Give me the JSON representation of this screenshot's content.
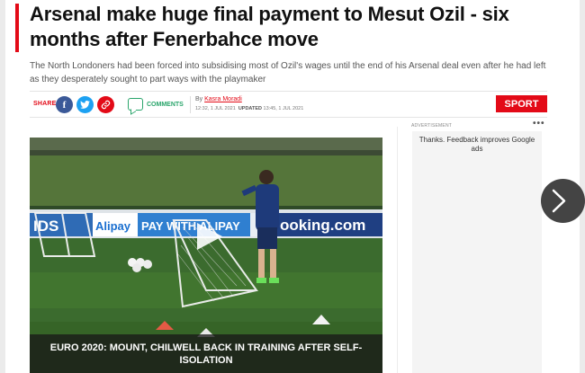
{
  "article": {
    "headline": "Arsenal make huge final payment to Mesut Ozil - six months after Fenerbahce move",
    "standfirst": "The North Londoners had been forced into subsidising most of Ozil's wages until the end of his Arsenal deal even after he had left as they desperately sought to part ways with the playmaker",
    "section_button": "SPORT"
  },
  "share": {
    "label": "SHARE",
    "facebook_glyph": "f",
    "comments_label": "COMMENTS"
  },
  "byline": {
    "by": "By",
    "author": "Kasra Moradi",
    "published": "12:32, 1 JUL 2021",
    "updated_label": "UPDATED",
    "updated": "13:45, 1 JUL 2021"
  },
  "video": {
    "caption": "EURO 2020: MOUNT, CHILWELL BACK IN TRAINING AFTER SELF-ISOLATION",
    "billboard_text_1": "Alipay",
    "billboard_text_2": "PAY WITH ALIPAY",
    "billboard_text_3": "ooking.com",
    "billboard_text_4": "IDS"
  },
  "ad": {
    "label": "ADVERTISEMENT",
    "menu": "•••",
    "message": "Thanks. Feedback improves Google ads"
  },
  "icons": {
    "facebook": "facebook-icon",
    "twitter": "twitter-icon",
    "link": "link-icon",
    "comments": "comment-bubble-icon",
    "play": "play-icon",
    "next": "chevron-right-icon"
  },
  "colors": {
    "accent": "#e30a17",
    "facebook": "#3b5998",
    "twitter": "#1da1f2",
    "comments": "#2aa56b"
  }
}
